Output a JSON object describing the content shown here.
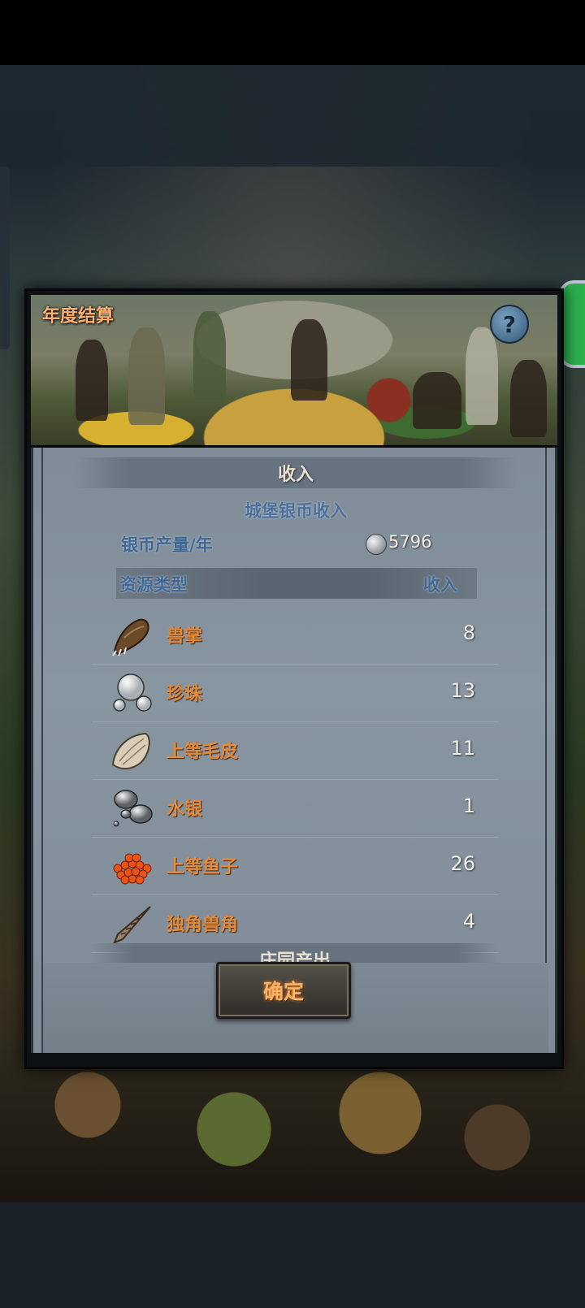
{
  "dialog": {
    "title": "年度结算",
    "help_label": "?",
    "section_header": "收入",
    "castle_income_title": "城堡银币收入",
    "silver_rate_label": "银币产量/年",
    "silver_rate_value": "5796",
    "columns": {
      "type": "资源类型",
      "income": "收入"
    },
    "resources": [
      {
        "name": "兽掌",
        "value": "8",
        "icon": "beast-paw-icon"
      },
      {
        "name": "珍珠",
        "value": "13",
        "icon": "pearl-icon"
      },
      {
        "name": "上等毛皮",
        "value": "11",
        "icon": "fur-icon"
      },
      {
        "name": "水银",
        "value": "1",
        "icon": "mercury-icon"
      },
      {
        "name": "上等鱼子",
        "value": "26",
        "icon": "caviar-icon"
      },
      {
        "name": "独角兽角",
        "value": "4",
        "icon": "unicorn-horn-icon"
      }
    ],
    "next_section_partial": "庄园产出",
    "confirm_label": "确定"
  }
}
